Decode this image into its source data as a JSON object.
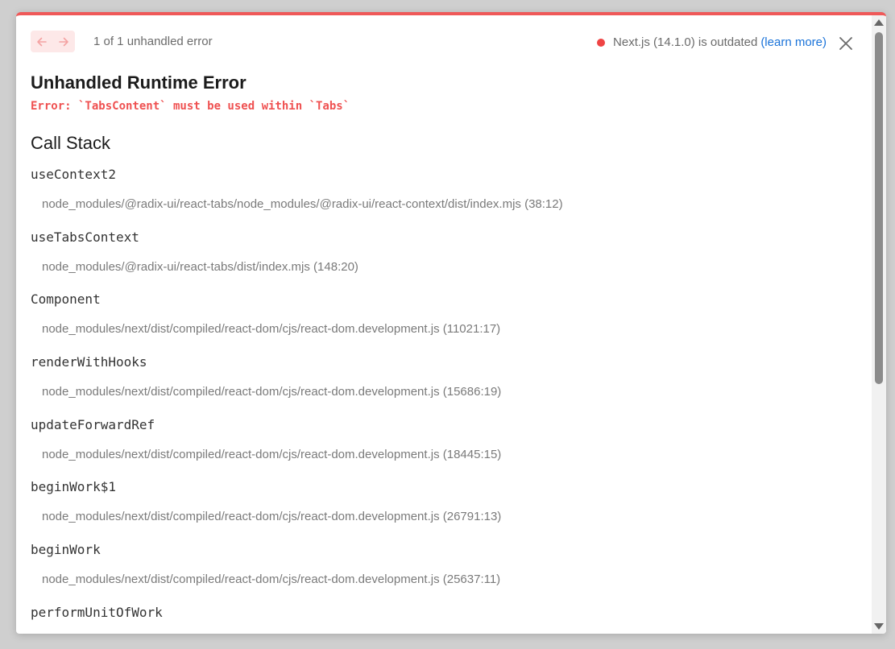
{
  "header": {
    "error_count": "1 of 1 unhandled error",
    "version_text": "Next.js (14.1.0) is outdated",
    "learn_more": "(learn more)",
    "icons": {
      "prev": "arrow-left-icon",
      "next": "arrow-right-icon",
      "close": "close-icon",
      "status": "status-dot"
    },
    "status_color": "#ef4444"
  },
  "error": {
    "title": "Unhandled Runtime Error",
    "message": "Error: `TabsContent` must be used within `Tabs`"
  },
  "callstack": {
    "heading": "Call Stack",
    "frames": [
      {
        "fn": "useContext2",
        "loc": "node_modules/@radix-ui/react-tabs/node_modules/@radix-ui/react-context/dist/index.mjs (38:12)"
      },
      {
        "fn": "useTabsContext",
        "loc": "node_modules/@radix-ui/react-tabs/dist/index.mjs (148:20)"
      },
      {
        "fn": "Component",
        "loc": "node_modules/next/dist/compiled/react-dom/cjs/react-dom.development.js (11021:17)"
      },
      {
        "fn": "renderWithHooks",
        "loc": "node_modules/next/dist/compiled/react-dom/cjs/react-dom.development.js (15686:19)"
      },
      {
        "fn": "updateForwardRef",
        "loc": "node_modules/next/dist/compiled/react-dom/cjs/react-dom.development.js (18445:15)"
      },
      {
        "fn": "beginWork$1",
        "loc": "node_modules/next/dist/compiled/react-dom/cjs/react-dom.development.js (26791:13)"
      },
      {
        "fn": "beginWork",
        "loc": "node_modules/next/dist/compiled/react-dom/cjs/react-dom.development.js (25637:11)"
      },
      {
        "fn": "performUnitOfWork",
        "loc": ""
      }
    ]
  },
  "colors": {
    "accent": "#ef5959",
    "link": "#1a73d9"
  }
}
